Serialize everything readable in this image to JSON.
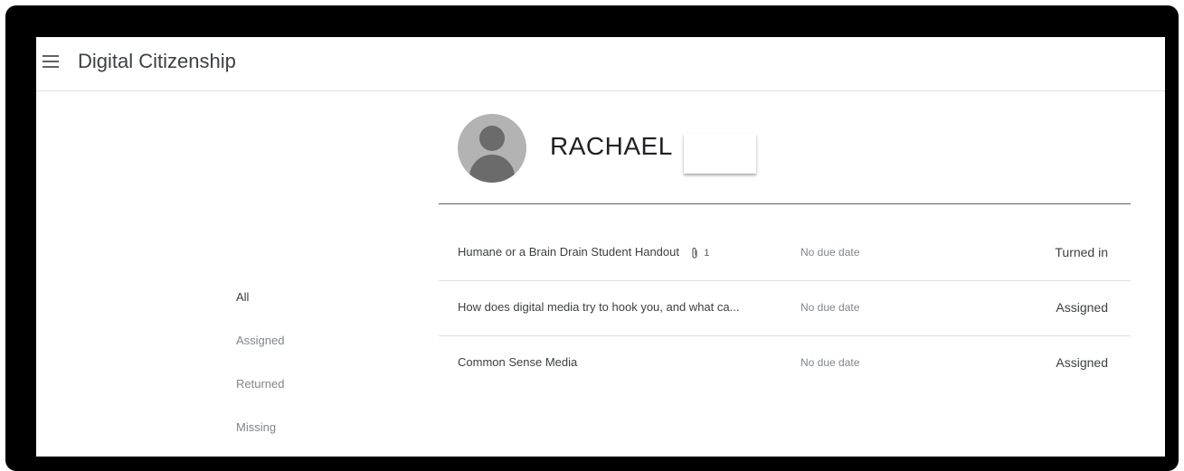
{
  "header": {
    "class_title": "Digital Citizenship"
  },
  "student": {
    "name": "RACHAEL"
  },
  "filters": [
    {
      "label": "All",
      "active": true
    },
    {
      "label": "Assigned",
      "active": false
    },
    {
      "label": "Returned",
      "active": false
    },
    {
      "label": "Missing",
      "active": false
    }
  ],
  "assignments": [
    {
      "title": "Humane or a Brain Drain Student Handout",
      "attachments": "1",
      "due": "No due date",
      "status": "Turned in"
    },
    {
      "title": "How does digital media try to hook you, and what ca...",
      "due": "No due date",
      "status": "Assigned"
    },
    {
      "title": "Common Sense Media",
      "due": "No due date",
      "status": "Assigned"
    }
  ],
  "icons": {
    "menu": "menu-icon",
    "avatar": "default-avatar-icon",
    "attachment": "paperclip-icon"
  }
}
